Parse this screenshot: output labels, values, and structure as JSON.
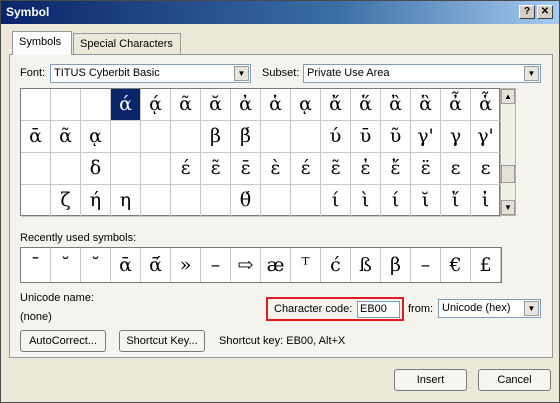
{
  "window": {
    "title": "Symbol",
    "help_label": "?",
    "close_label": "✕"
  },
  "tabs": {
    "symbols": "Symbols",
    "special": "Special Characters"
  },
  "font": {
    "label": "Font:",
    "value": "TITUS Cyberbit Basic"
  },
  "subset": {
    "label": "Subset:",
    "value": "Private Use Area"
  },
  "grid": {
    "rows": [
      [
        "",
        "",
        "",
        "ά",
        "ᾴ",
        "ᾶ",
        "ᾰ",
        "ἀ",
        "ἁ",
        "ᾳ",
        "ἄ",
        "ἅ",
        "ἂ",
        "ἃ",
        "ἆ",
        "ἇ"
      ],
      [
        "ᾱ",
        "ᾶ",
        "ᾳ",
        "",
        "",
        "",
        "β",
        "β́",
        "",
        "",
        "ύ",
        "ῡ",
        "ῦ",
        "γ'",
        "γ",
        "γ'"
      ],
      [
        "",
        "",
        "δ",
        "",
        "",
        "έ",
        "ε̃",
        "ε̄",
        "ὲ",
        "έ",
        "ε̃",
        "ἐ",
        "ἔ",
        "ε̈",
        "ε",
        "ε"
      ],
      [
        "",
        "ζ",
        "ή",
        "η",
        "",
        "",
        "",
        "θ́",
        "",
        "",
        "ί",
        "ὶ",
        "ί",
        "ῐ",
        "ἴ",
        "ἰ"
      ]
    ],
    "selected": "ά"
  },
  "recent": {
    "label": "Recently used symbols:",
    "items": [
      "¯",
      "˘",
      "˘",
      "ᾱ",
      "ᾱ́",
      "»",
      "–",
      "⇨",
      "æ",
      "ᵀ",
      "ć",
      "ß",
      "β",
      "–",
      "€",
      "£"
    ]
  },
  "unicode": {
    "name_label": "Unicode name:",
    "name_value": "(none)"
  },
  "code": {
    "label": "Character code:",
    "value": "EB00",
    "from_label": "from:",
    "from_value": "Unicode (hex)"
  },
  "buttons": {
    "autocorrect": "AutoCorrect...",
    "shortcut": "Shortcut Key...",
    "insert": "Insert",
    "cancel": "Cancel"
  },
  "shortcut_info": "Shortcut key: EB00, Alt+X",
  "colors": {
    "selected_cell": "#0a246a",
    "highlight": "#e01b24",
    "titlebar": "#0a246a"
  },
  "icons": {
    "dropdown": "chevron-down-icon",
    "scroll_up": "arrow-up-icon",
    "scroll_down": "arrow-down-icon"
  }
}
